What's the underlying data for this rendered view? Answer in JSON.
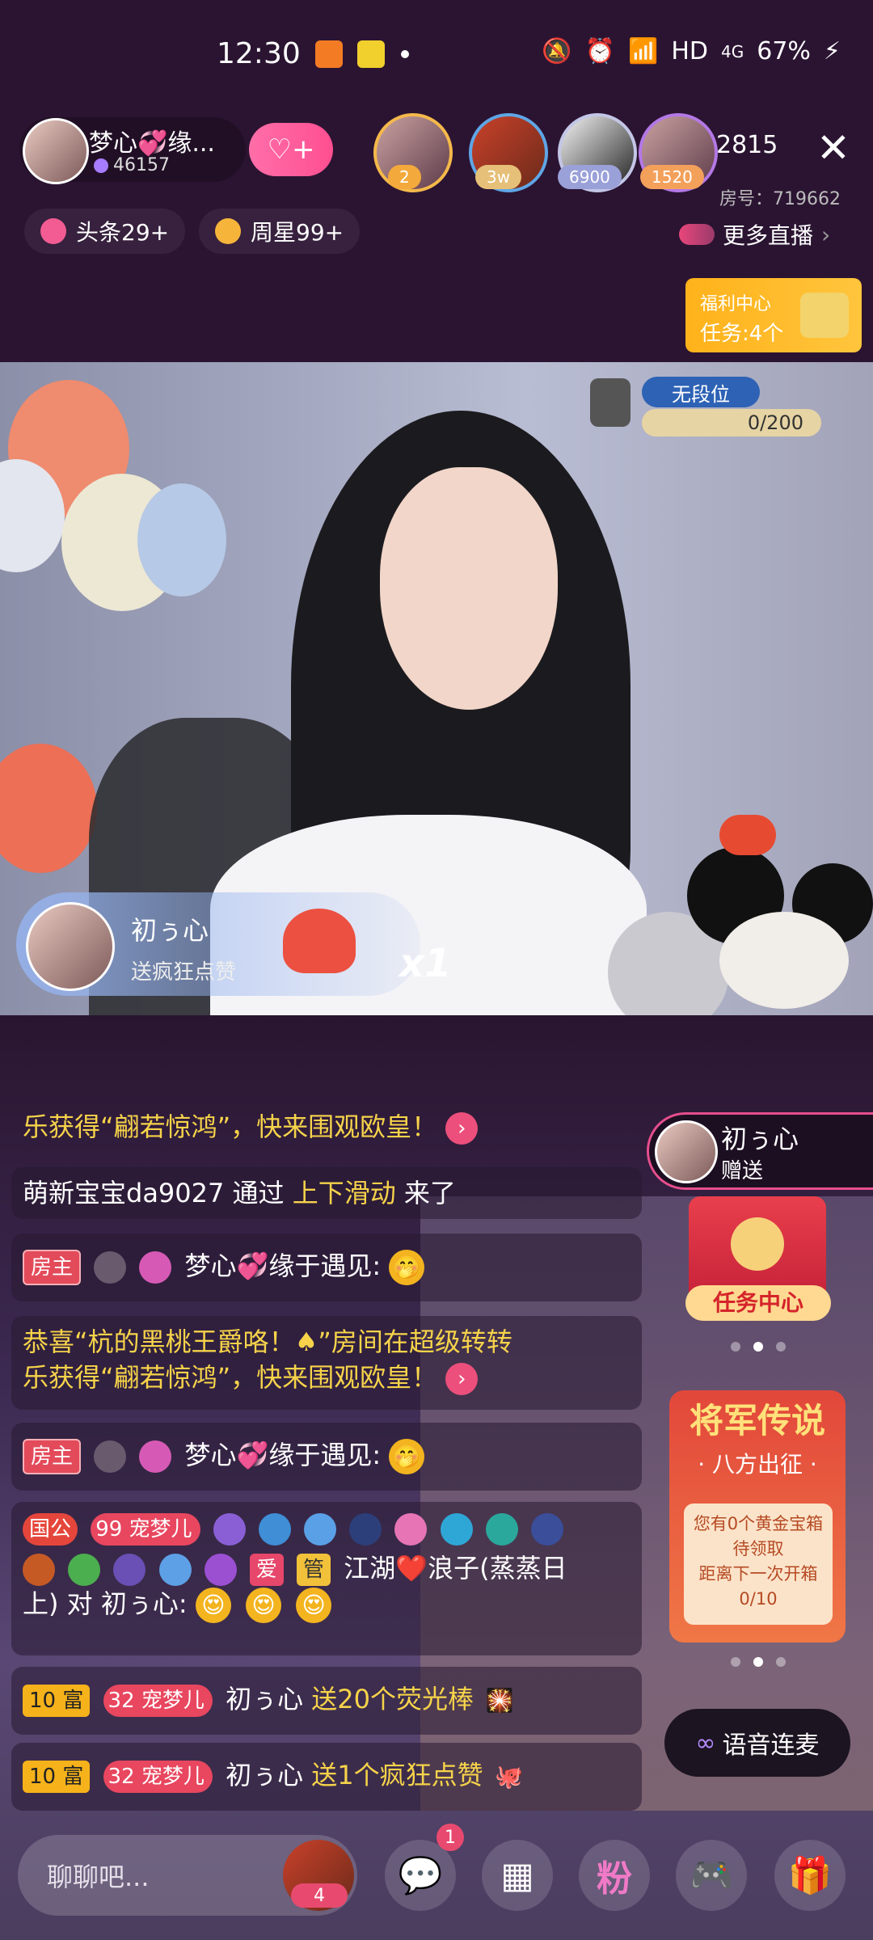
{
  "status_bar": {
    "time": "12:30",
    "network": "HD",
    "signal": "4G",
    "battery": "67%"
  },
  "header": {
    "anchor_name": "梦心💞缘...",
    "anchor_fans": "46157",
    "viewers": [
      {
        "badge": "2",
        "color": "#f3a93b"
      },
      {
        "badge": "3w",
        "color": "#e6c078"
      },
      {
        "badge": "6900",
        "color": "#9aa0d8"
      },
      {
        "badge": "1520",
        "color": "#f3a05b"
      }
    ],
    "viewer_count": "2815",
    "room_number": "房号：719662",
    "chips": [
      {
        "label": "头条29+",
        "color": "#f25c93"
      },
      {
        "label": "周星99+",
        "color": "#f6b53a"
      }
    ],
    "more_live": "更多直播",
    "welfare_title": "福利中心",
    "welfare_task": "任务:4个"
  },
  "video": {
    "rank_label": "无段位",
    "rank_progress": "0/200",
    "like_user": "初ぅ心",
    "like_action": "送疯狂点赞",
    "like_multiplier": "x1"
  },
  "chat": {
    "msg0_text": "乐获得“翩若惊鸿”，快来围观欧皇！",
    "msg1_user": "萌新宝宝da9027 通过 ",
    "msg1_highlight": "上下滑动",
    "msg1_tail": " 来了",
    "host_tag": "房主",
    "msg2_user": "梦心💞缘于遇见:",
    "msg3_line1": "恭喜“杭的黑桃王爵咯！♠”房间在超级转转",
    "msg3_line2": "乐获得“翩若惊鸿”，快来围观欧皇！",
    "msg4_user": "梦心💞缘于遇见:",
    "gov_tag": "国公",
    "pet_level": "99",
    "pet_name": "宠梦儿",
    "love_tag": "爱",
    "manage_tag": "管",
    "msg5_user": "江湖❤️浪子(蒸蒸日",
    "msg5_line2_a": "上) 对 初ぅ心:",
    "rich_tag": "10 富",
    "pet_level2": "32",
    "msg6_user": "初ぅ心 ",
    "msg6_gift": "送20个荧光棒",
    "msg7_user": "初ぅ心 ",
    "msg7_gift": "送1个疯狂点赞"
  },
  "side": {
    "gift_user": "初ぅ心",
    "gift_action": "赠送",
    "task_center": "任务中心",
    "legend_title": "将军传说",
    "legend_sub": "· 八方出征 ·",
    "legend_line1": "您有0个黄金宝箱",
    "legend_line2": "待领取",
    "legend_line3": "距离下一次开箱",
    "legend_line4": "0/10",
    "voice_link": "语音连麦"
  },
  "bottom": {
    "input_placeholder": "聊聊吧...",
    "gift_count": "4",
    "message_badge": "1",
    "fan_label": "粉"
  }
}
